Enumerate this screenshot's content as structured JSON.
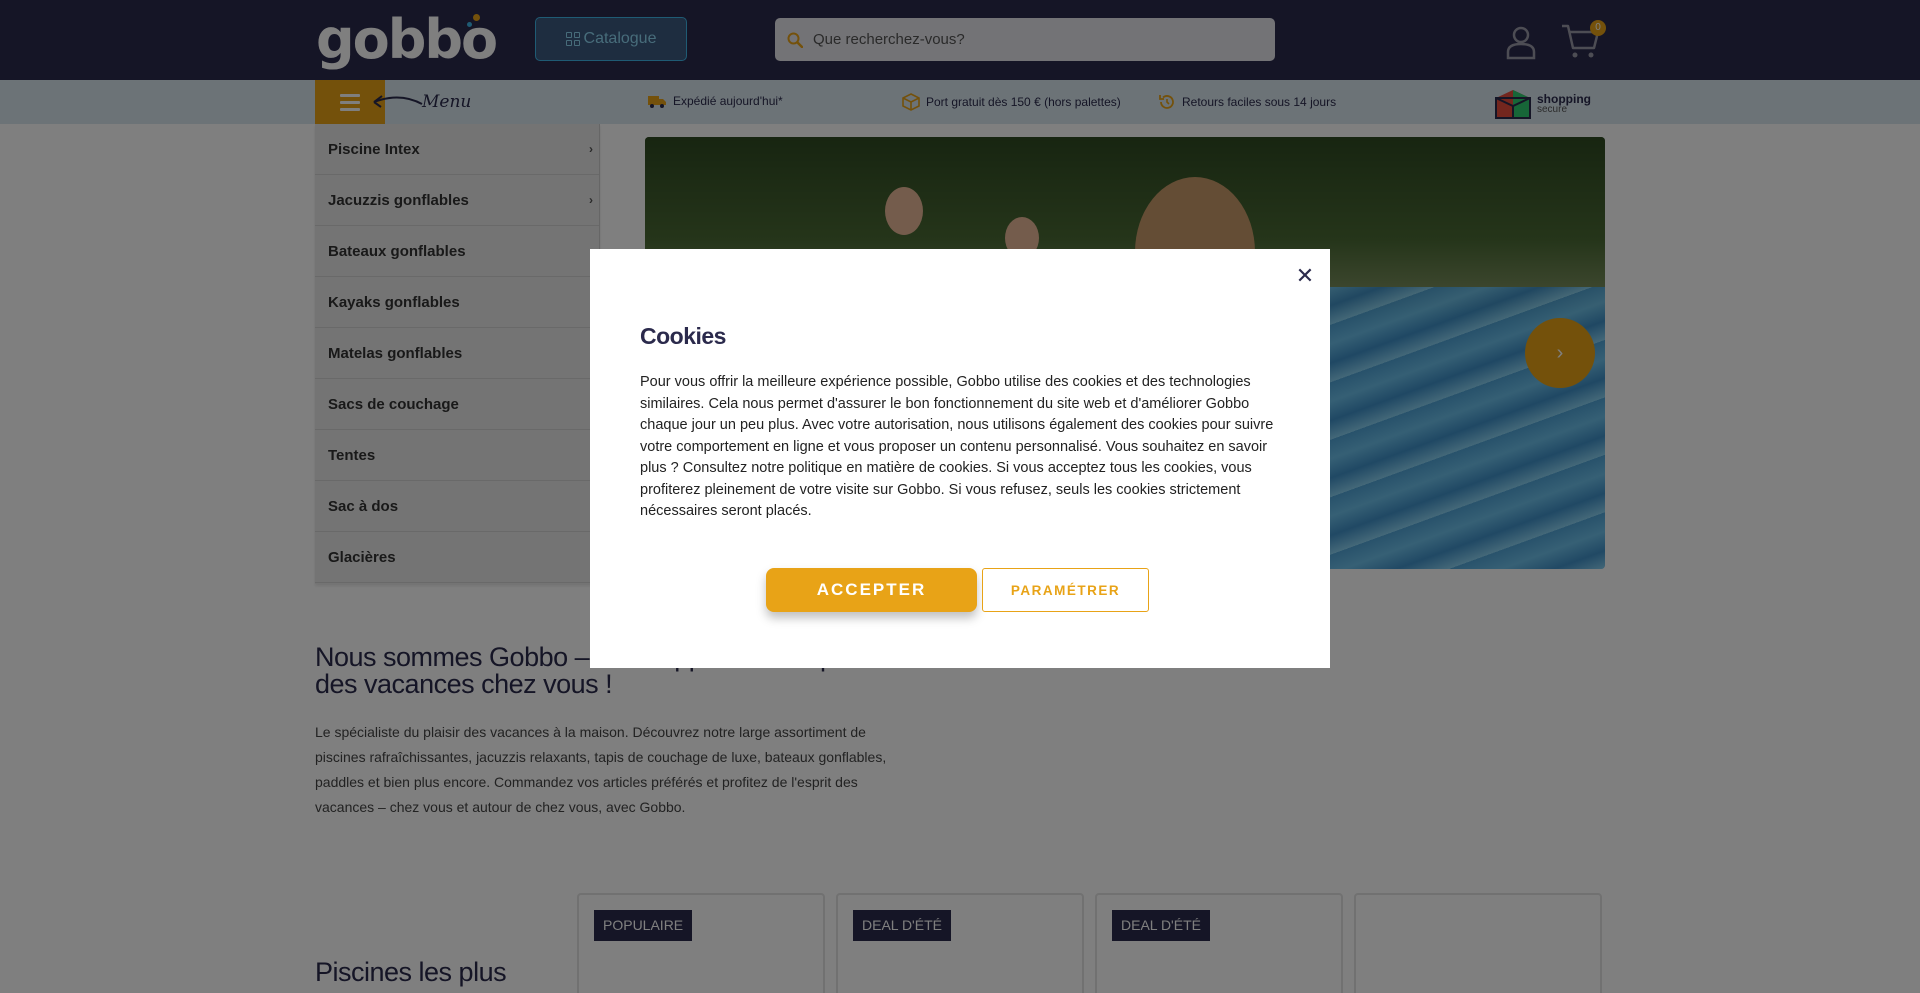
{
  "header": {
    "logo_text": "gobbo",
    "catalogue_label": "Catalogue",
    "search_placeholder": "Que recherchez-vous?",
    "cart_count": "0"
  },
  "infobar": {
    "menu_hint": "Menu",
    "items": [
      {
        "label": "Expédié aujourd'hui*",
        "icon": "truck-icon"
      },
      {
        "label": "Port gratuit dès 150 € (hors palettes)",
        "icon": "box-icon"
      },
      {
        "label": "Retours faciles sous 14 jours",
        "icon": "return-icon"
      }
    ],
    "secure_title": "shopping",
    "secure_subtitle": "secure"
  },
  "sidebar": {
    "items": [
      {
        "label": "Piscine Intex",
        "has_children": true
      },
      {
        "label": "Jacuzzis gonflables",
        "has_children": true
      },
      {
        "label": "Bateaux gonflables",
        "has_children": false
      },
      {
        "label": "Kayaks gonflables",
        "has_children": false
      },
      {
        "label": "Matelas gonflables",
        "has_children": false
      },
      {
        "label": "Sacs de couchage",
        "has_children": false
      },
      {
        "label": "Tentes",
        "has_children": false
      },
      {
        "label": "Sac à dos",
        "has_children": false
      },
      {
        "label": "Glacières",
        "has_children": false
      }
    ]
  },
  "about": {
    "title": "Nous sommes Gobbo – nous apportons l'esprit des vacances chez vous !",
    "text": "Le spécialiste du plaisir des vacances à la maison. Découvrez notre large assortiment de piscines rafraîchissantes, jacuzzis relaxants, tapis de couchage de luxe, bateaux gonflables, paddles et bien plus encore. Commandez vos articles préférés et profitez de l'esprit des vacances – chez vous et autour de chez vous, avec Gobbo."
  },
  "products": {
    "section_title": "Piscines les plus",
    "badges": [
      "POPULAIRE",
      "DEAL D'ÉTÉ",
      "DEAL D'ÉTÉ"
    ]
  },
  "cookie_modal": {
    "title": "Cookies",
    "text": "Pour vous offrir la meilleure expérience possible, Gobbo utilise des cookies et des technologies similaires. Cela nous permet d'assurer le bon fonctionnement du site web et d'améliorer Gobbo chaque jour un peu plus. Avec votre autorisation, nous utilisons également des cookies pour suivre votre comportement en ligne et vous proposer un contenu personnalisé. Vous souhaitez en savoir plus ? Consultez notre politique en matière de cookies. Si vous acceptez tous les cookies, vous profiterez pleinement de votre visite sur Gobbo. Si vous refusez, seuls les cookies strictement nécessaires seront placés.",
    "accept_label": "ACCEPTER",
    "settings_label": "PARAMÉTRER",
    "close_label": "✕"
  },
  "colors": {
    "brand_dark": "#2b2a4c",
    "accent": "#e8a317",
    "infobar_bg": "#d9e7ef"
  }
}
